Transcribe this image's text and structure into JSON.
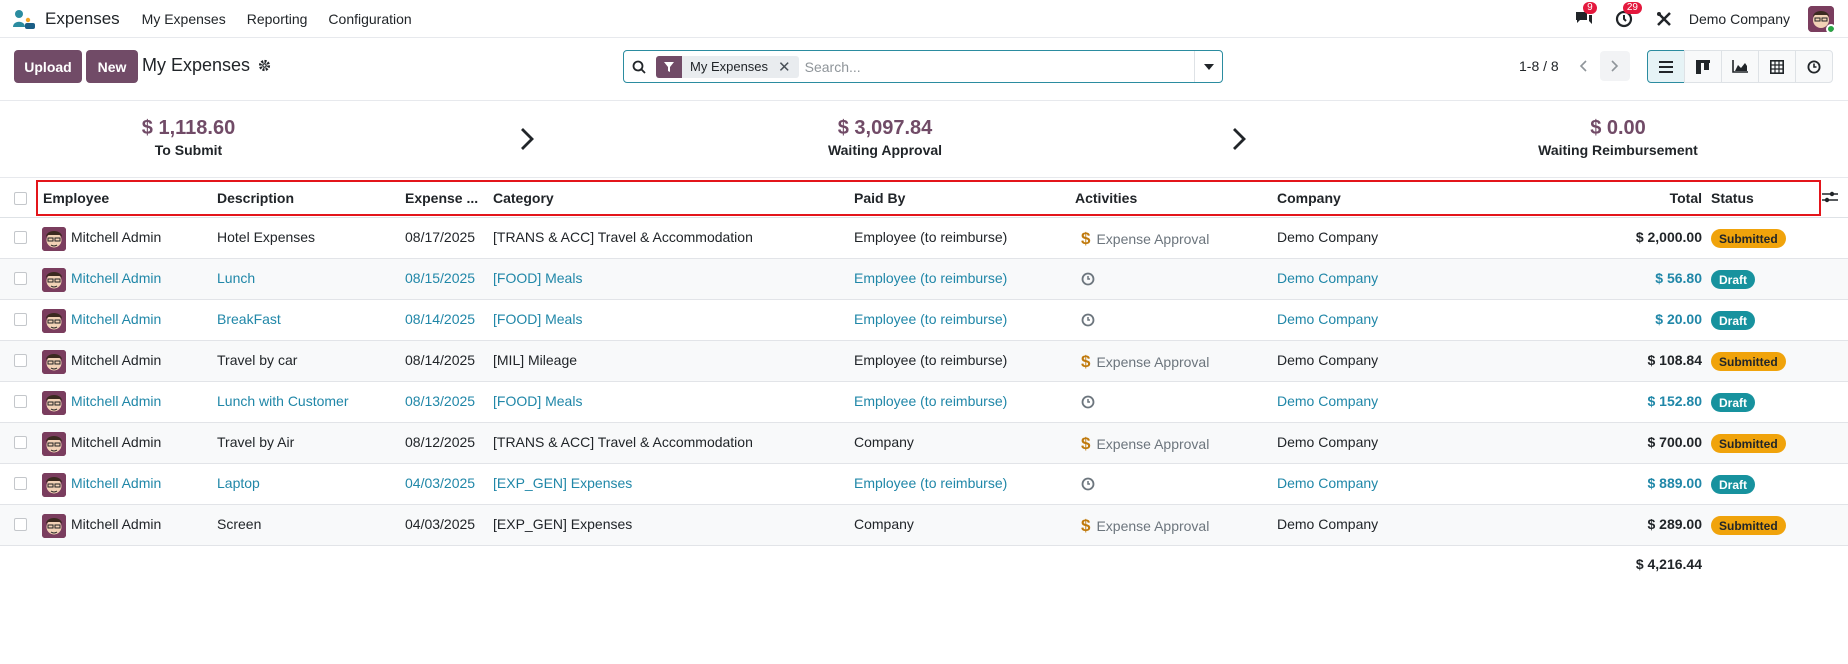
{
  "navbar": {
    "app_name": "Expenses",
    "menu": [
      "My Expenses",
      "Reporting",
      "Configuration"
    ],
    "messages_count": "9",
    "activities_count": "29",
    "company": "Demo Company"
  },
  "control": {
    "upload_label": "Upload",
    "new_label": "New",
    "title": "My Expenses",
    "facet_label": "My Expenses",
    "search_placeholder": "Search...",
    "pager": "1-8 / 8"
  },
  "summary": [
    {
      "amount": "$ 1,118.60",
      "label": "To Submit"
    },
    {
      "amount": "$ 3,097.84",
      "label": "Waiting Approval"
    },
    {
      "amount": "$ 0.00",
      "label": "Waiting Reimbursement"
    }
  ],
  "columns": {
    "employee": "Employee",
    "description": "Description",
    "expense_date": "Expense ...",
    "category": "Category",
    "paid_by": "Paid By",
    "activities": "Activities",
    "company": "Company",
    "total": "Total",
    "status": "Status"
  },
  "rows": [
    {
      "employee": "Mitchell Admin",
      "description": "Hotel Expenses",
      "date": "08/17/2025",
      "category": "[TRANS & ACC] Travel & Accommodation",
      "paid_by": "Employee (to reimburse)",
      "activity": "Expense Approval",
      "company": "Demo Company",
      "total": "$ 2,000.00",
      "status": "Submitted"
    },
    {
      "employee": "Mitchell Admin",
      "description": "Lunch",
      "date": "08/15/2025",
      "category": "[FOOD] Meals",
      "paid_by": "Employee (to reimburse)",
      "activity": "",
      "company": "Demo Company",
      "total": "$ 56.80",
      "status": "Draft"
    },
    {
      "employee": "Mitchell Admin",
      "description": "BreakFast",
      "date": "08/14/2025",
      "category": "[FOOD] Meals",
      "paid_by": "Employee (to reimburse)",
      "activity": "",
      "company": "Demo Company",
      "total": "$ 20.00",
      "status": "Draft"
    },
    {
      "employee": "Mitchell Admin",
      "description": "Travel by car",
      "date": "08/14/2025",
      "category": "[MIL] Mileage",
      "paid_by": "Employee (to reimburse)",
      "activity": "Expense Approval",
      "company": "Demo Company",
      "total": "$ 108.84",
      "status": "Submitted"
    },
    {
      "employee": "Mitchell Admin",
      "description": "Lunch with Customer",
      "date": "08/13/2025",
      "category": "[FOOD] Meals",
      "paid_by": "Employee (to reimburse)",
      "activity": "",
      "company": "Demo Company",
      "total": "$ 152.80",
      "status": "Draft"
    },
    {
      "employee": "Mitchell Admin",
      "description": "Travel by Air",
      "date": "08/12/2025",
      "category": "[TRANS & ACC] Travel & Accommodation",
      "paid_by": "Company",
      "activity": "Expense Approval",
      "company": "Demo Company",
      "total": "$ 700.00",
      "status": "Submitted"
    },
    {
      "employee": "Mitchell Admin",
      "description": "Laptop",
      "date": "04/03/2025",
      "category": "[EXP_GEN] Expenses",
      "paid_by": "Employee (to reimburse)",
      "activity": "",
      "company": "Demo Company",
      "total": "$ 889.00",
      "status": "Draft"
    },
    {
      "employee": "Mitchell Admin",
      "description": "Screen",
      "date": "04/03/2025",
      "category": "[EXP_GEN] Expenses",
      "paid_by": "Company",
      "activity": "Expense Approval",
      "company": "Demo Company",
      "total": "$ 289.00",
      "status": "Submitted"
    }
  ],
  "footer_total": "$ 4,216.44",
  "colors": {
    "brand": "#714b67",
    "link": "#2087a8",
    "submitted": "#f0a30b",
    "draft": "#17929e",
    "highlight": "#e3151b"
  }
}
